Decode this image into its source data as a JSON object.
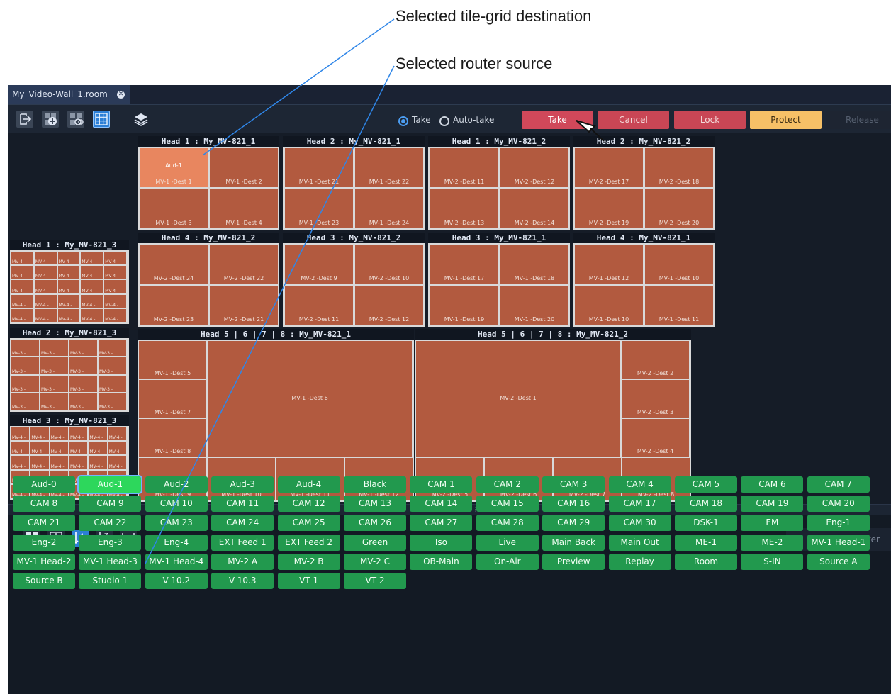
{
  "callouts": {
    "selected_destination": "Selected tile-grid destination",
    "selected_source": "Selected router source"
  },
  "tab": {
    "title": "My_Video-Wall_1.room",
    "close_glyph": "✕"
  },
  "toolbar": {
    "icons": [
      "exit-icon",
      "add-tile-icon",
      "link-tile-icon",
      "grid-edit-icon",
      "layers-icon"
    ],
    "radio_take": "Take",
    "radio_auto_take": "Auto-take",
    "take": "Take",
    "cancel": "Cancel",
    "lock": "Lock",
    "protect": "Protect",
    "release": "Release"
  },
  "heads_row1": [
    {
      "title": "Head 1 : My_MV-821_1",
      "tiles": [
        "MV-1 -Dest 1",
        "MV-1 -Dest 2",
        "MV-1 -Dest 3",
        "MV-1 -Dest 4"
      ],
      "selected_source": "Aud-1"
    },
    {
      "title": "Head 2 : My_MV-821_1",
      "tiles": [
        "MV-1 -Dest 21",
        "MV-1 -Dest 22",
        "MV-1 -Dest 23",
        "MV-1 -Dest 24"
      ]
    },
    {
      "title": "Head 1 : My_MV-821_2",
      "tiles": [
        "MV-2 -Dest 11",
        "MV-2 -Dest 12",
        "MV-2 -Dest 13",
        "MV-2 -Dest 14"
      ]
    },
    {
      "title": "Head 2 : My_MV-821_2",
      "tiles": [
        "MV-2 -Dest 17",
        "MV-2 -Dest 18",
        "MV-2 -Dest 19",
        "MV-2 -Dest 20"
      ]
    }
  ],
  "heads_row2": [
    {
      "title": "Head 4 : My_MV-821_2",
      "tiles": [
        "MV-2 -Dest 24",
        "MV-2 -Dest 22",
        "MV-2 -Dest 23",
        "MV-2 -Dest 21"
      ]
    },
    {
      "title": "Head 3 : My_MV-821_2",
      "tiles": [
        "MV-2 -Dest 9",
        "MV-2 -Dest 10",
        "MV-2 -Dest 11",
        "MV-2 -Dest 12"
      ]
    },
    {
      "title": "Head 3 : My_MV-821_1",
      "tiles": [
        "MV-1 -Dest 17",
        "MV-1 -Dest 18",
        "MV-1 -Dest 19",
        "MV-1 -Dest 20"
      ]
    },
    {
      "title": "Head 4 : My_MV-821_1",
      "tiles": [
        "MV-1 -Dest 12",
        "MV-1 -Dest 10",
        "MV-1 -Dest 10",
        "MV-1 -Dest 11"
      ]
    }
  ],
  "side_heads": [
    {
      "title": "Head 1 : My_MV-821_3",
      "label": "MV-4 -"
    },
    {
      "title": "Head 2 : My_MV-821_3",
      "label": "MV-3 -"
    },
    {
      "title": "Head 3 : My_MV-821_3",
      "label": "MV-4 -"
    }
  ],
  "big_heads": [
    {
      "title": "Head 5 | 6 | 7 | 8 : My_MV-821_1",
      "left": [
        "MV-1 -Dest 5",
        "MV-1 -Dest 7",
        "MV-1 -Dest 8"
      ],
      "big": "MV-1 -Dest 6",
      "bottom": [
        "MV-1 -Dest 9",
        "MV-1 -Dest 10",
        "MV-1 -Dest 11",
        "MV-1 -Dest 12"
      ]
    },
    {
      "title": "Head 5 | 6 | 7 | 8 : My_MV-821_2",
      "right": [
        "MV-2 -Dest 2",
        "MV-2 -Dest 3",
        "MV-2 -Dest 4"
      ],
      "big": "MV-2 -Dest 1",
      "bottom": [
        "MV-2 -Dest 5",
        "MV-2 -Dest 6",
        "MV-2 -Dest 7",
        "MV-2 -Dest 8"
      ]
    }
  ],
  "sourcebar": {
    "icons": [
      "large-tiles-icon",
      "small-tiles-icon",
      "sort-az-icon",
      "sort-za-icon",
      "fit-width-icon"
    ],
    "filter_placeholder": "filter"
  },
  "sources": [
    "Aud-0",
    "Aud-1",
    "Aud-2",
    "Aud-3",
    "Aud-4",
    "Black",
    "CAM 1",
    "CAM 2",
    "CAM 3",
    "CAM 4",
    "CAM 5",
    "CAM 6",
    "CAM 7",
    "CAM 8",
    "CAM 9",
    "CAM 10",
    "CAM 11",
    "CAM 12",
    "CAM 13",
    "CAM 14",
    "CAM 15",
    "CAM 16",
    "CAM 17",
    "CAM 18",
    "CAM 19",
    "CAM 20",
    "CAM 21",
    "CAM 22",
    "CAM 23",
    "CAM 24",
    "CAM 25",
    "CAM 26",
    "CAM 27",
    "CAM 28",
    "CAM 29",
    "CAM 30",
    "DSK-1",
    "EM",
    "Eng-1",
    "Eng-2",
    "Eng-3",
    "Eng-4",
    "EXT Feed 1",
    "EXT Feed 2",
    "Green",
    "Iso",
    "Live",
    "Main Back",
    "Main Out",
    "ME-1",
    "ME-2",
    "MV-1 Head-1",
    "MV-1 Head-2",
    "MV-1 Head-3",
    "MV-1 Head-4",
    "MV-2 A",
    "MV-2 B",
    "MV-2 C",
    "OB-Main",
    "On-Air",
    "Preview",
    "Replay",
    "Room",
    "S-IN",
    "Source A",
    "Source B",
    "Studio 1",
    "V-10.2",
    "V-10.3",
    "VT 1",
    "VT 2"
  ],
  "selected_source_name": "Aud-1",
  "colors": {
    "tile": "#b25a3f",
    "tile_selected": "#e8865f",
    "source": "#22994e",
    "source_selected": "#2dd75c",
    "take": "#d0485a",
    "protect": "#f6c067",
    "callout_line": "#2f86e8"
  }
}
